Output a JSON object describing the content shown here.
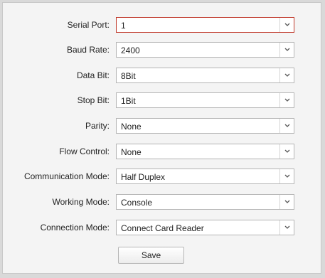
{
  "form": {
    "fields": [
      {
        "label": "Serial Port:",
        "value": "1"
      },
      {
        "label": "Baud Rate:",
        "value": "2400"
      },
      {
        "label": "Data Bit:",
        "value": "8Bit"
      },
      {
        "label": "Stop Bit:",
        "value": "1Bit"
      },
      {
        "label": "Parity:",
        "value": "None"
      },
      {
        "label": "Flow Control:",
        "value": "None"
      },
      {
        "label": "Communication Mode:",
        "value": "Half Duplex"
      },
      {
        "label": "Working Mode:",
        "value": "Console"
      },
      {
        "label": "Connection Mode:",
        "value": "Connect Card Reader"
      }
    ],
    "save_label": "Save"
  },
  "icons": {
    "dropdown": "chevron-down-icon"
  },
  "colors": {
    "focus_border": "#c0392b",
    "panel_background": "#f4f4f4",
    "field_border": "#b5b5b5"
  }
}
